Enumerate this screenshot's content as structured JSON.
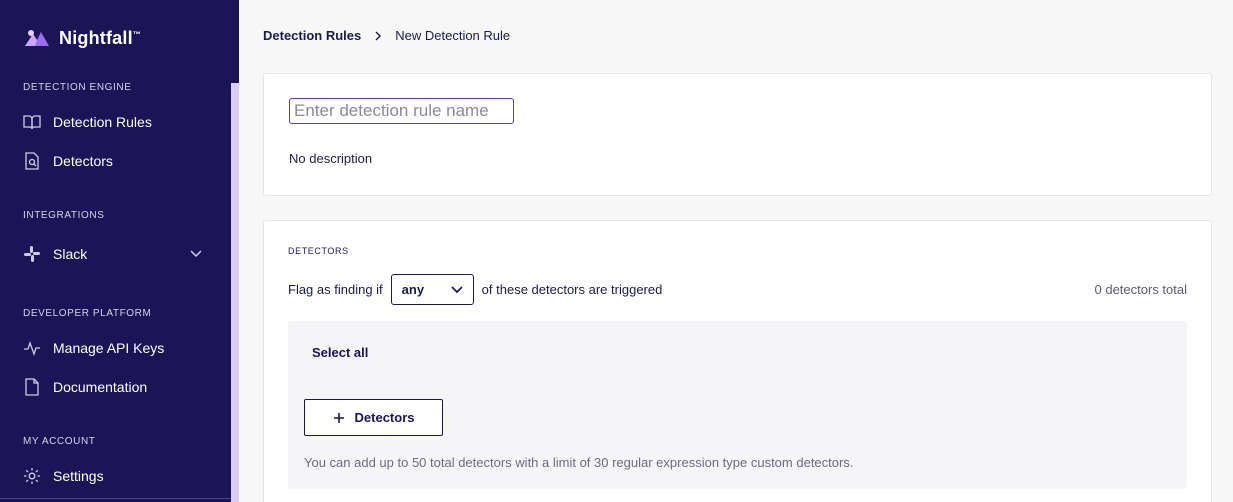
{
  "brand": {
    "name": "Nightfall",
    "tm": "™"
  },
  "sidebar": {
    "sections": [
      {
        "title": "DETECTION ENGINE"
      },
      {
        "title": "INTEGRATIONS"
      },
      {
        "title": "DEVELOPER PLATFORM"
      },
      {
        "title": "MY ACCOUNT"
      }
    ],
    "items": [
      {
        "label": "Detection Rules",
        "icon": "book-open-icon"
      },
      {
        "label": "Detectors",
        "icon": "file-search-icon"
      },
      {
        "label": "Slack",
        "icon": "slack-icon"
      },
      {
        "label": "Manage API Keys",
        "icon": "activity-icon"
      },
      {
        "label": "Documentation",
        "icon": "file-icon"
      },
      {
        "label": "Settings",
        "icon": "gear-icon"
      }
    ]
  },
  "breadcrumb": {
    "parent": "Detection Rules",
    "current": "New Detection Rule"
  },
  "rule": {
    "name_placeholder": "Enter detection rule name",
    "name_value": "",
    "description": "No description"
  },
  "detectors": {
    "title": "DETECTORS",
    "flag_prefix": "Flag as finding if",
    "match_mode": "any",
    "flag_suffix": "of these detectors are triggered",
    "total": "0 detectors total",
    "select_all": "Select all",
    "add_button": "Detectors",
    "hint": "You can add up to 50 total detectors with a limit of 30 regular expression type custom detectors."
  },
  "colors": {
    "sidebar_bg": "#1b1456",
    "accent": "#4f3cc9",
    "scroll_track": "#d9cdf3"
  }
}
